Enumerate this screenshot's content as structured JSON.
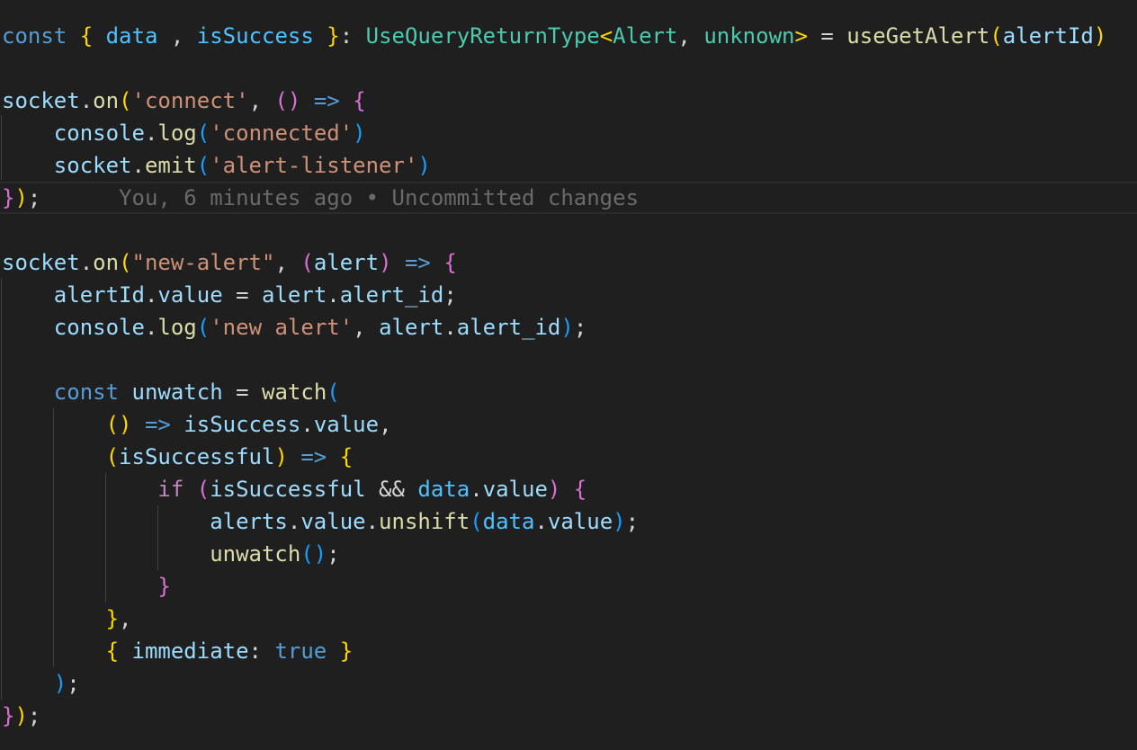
{
  "colors": {
    "background": "#1f1f1f",
    "keyword": "#569cd6",
    "control": "#c586c0",
    "variable": "#9cdcfe",
    "constant": "#4fc1ff",
    "function": "#dcdcaa",
    "type": "#4ec9b0",
    "string": "#ce9178",
    "bracket1": "#ffd700",
    "bracket2": "#da70d6",
    "bracket3": "#179fff",
    "punct": "#d4d4d4",
    "blame": "#6a6a6a",
    "guide": "#404040"
  },
  "lines": [
    {
      "name": "line-const-query",
      "tokens": [
        [
          "const",
          "keyword"
        ],
        [
          " ",
          "punct"
        ],
        [
          "{",
          "bracket1"
        ],
        [
          " ",
          "punct"
        ],
        [
          "data",
          "constant"
        ],
        [
          " , ",
          "punct"
        ],
        [
          "isSuccess",
          "constant"
        ],
        [
          " ",
          "punct"
        ],
        [
          "}",
          "bracket1"
        ],
        [
          ": ",
          "punct"
        ],
        [
          "UseQueryReturnType",
          "type"
        ],
        [
          "<",
          "bracket1"
        ],
        [
          "Alert",
          "type"
        ],
        [
          ", ",
          "punct"
        ],
        [
          "unknown",
          "type"
        ],
        [
          ">",
          "bracket1"
        ],
        [
          " = ",
          "punct"
        ],
        [
          "useGetAlert",
          "function"
        ],
        [
          "(",
          "bracket1"
        ],
        [
          "alertId",
          "variable"
        ],
        [
          ")",
          "bracket1"
        ]
      ]
    },
    {
      "name": "line-empty-1",
      "tokens": []
    },
    {
      "name": "line-socket-on-connect",
      "tokens": [
        [
          "socket",
          "variable"
        ],
        [
          ".",
          "punct"
        ],
        [
          "on",
          "function"
        ],
        [
          "(",
          "bracket1"
        ],
        [
          "'connect'",
          "string"
        ],
        [
          ", ",
          "punct"
        ],
        [
          "()",
          "bracket2"
        ],
        [
          " ",
          "punct"
        ],
        [
          "=>",
          "keyword"
        ],
        [
          " ",
          "punct"
        ],
        [
          "{",
          "bracket2"
        ]
      ]
    },
    {
      "name": "line-console-log-connected",
      "tokens": [
        [
          "    ",
          "punct"
        ],
        [
          "console",
          "variable"
        ],
        [
          ".",
          "punct"
        ],
        [
          "log",
          "function"
        ],
        [
          "(",
          "bracket3"
        ],
        [
          "'connected'",
          "string"
        ],
        [
          ")",
          "bracket3"
        ]
      ]
    },
    {
      "name": "line-socket-emit",
      "tokens": [
        [
          "    ",
          "punct"
        ],
        [
          "socket",
          "variable"
        ],
        [
          ".",
          "punct"
        ],
        [
          "emit",
          "function"
        ],
        [
          "(",
          "bracket3"
        ],
        [
          "'alert-listener'",
          "string"
        ],
        [
          ")",
          "bracket3"
        ]
      ]
    },
    {
      "name": "line-close-connect",
      "current": true,
      "tokens": [
        [
          "}",
          "bracket2"
        ],
        [
          ")",
          "bracket1"
        ],
        [
          ";",
          "punct"
        ]
      ],
      "blame": "      You, 6 minutes ago • Uncommitted changes"
    },
    {
      "name": "line-empty-2",
      "tokens": []
    },
    {
      "name": "line-socket-on-new-alert",
      "tokens": [
        [
          "socket",
          "variable"
        ],
        [
          ".",
          "punct"
        ],
        [
          "on",
          "function"
        ],
        [
          "(",
          "bracket1"
        ],
        [
          "\"new-alert\"",
          "string"
        ],
        [
          ", ",
          "punct"
        ],
        [
          "(",
          "bracket2"
        ],
        [
          "alert",
          "variable"
        ],
        [
          ")",
          "bracket2"
        ],
        [
          " ",
          "punct"
        ],
        [
          "=>",
          "keyword"
        ],
        [
          " ",
          "punct"
        ],
        [
          "{",
          "bracket2"
        ]
      ]
    },
    {
      "name": "line-alertid-assign",
      "tokens": [
        [
          "    ",
          "punct"
        ],
        [
          "alertId",
          "variable"
        ],
        [
          ".",
          "punct"
        ],
        [
          "value",
          "variable"
        ],
        [
          " = ",
          "punct"
        ],
        [
          "alert",
          "variable"
        ],
        [
          ".",
          "punct"
        ],
        [
          "alert_id",
          "variable"
        ],
        [
          ";",
          "punct"
        ]
      ]
    },
    {
      "name": "line-console-log-new-alert",
      "tokens": [
        [
          "    ",
          "punct"
        ],
        [
          "console",
          "variable"
        ],
        [
          ".",
          "punct"
        ],
        [
          "log",
          "function"
        ],
        [
          "(",
          "bracket3"
        ],
        [
          "'new alert'",
          "string"
        ],
        [
          ", ",
          "punct"
        ],
        [
          "alert",
          "variable"
        ],
        [
          ".",
          "punct"
        ],
        [
          "alert_id",
          "variable"
        ],
        [
          ")",
          "bracket3"
        ],
        [
          ";",
          "punct"
        ]
      ]
    },
    {
      "name": "line-empty-3",
      "tokens": []
    },
    {
      "name": "line-const-unwatch",
      "tokens": [
        [
          "    ",
          "punct"
        ],
        [
          "const",
          "keyword"
        ],
        [
          " ",
          "punct"
        ],
        [
          "unwatch",
          "variable"
        ],
        [
          " = ",
          "punct"
        ],
        [
          "watch",
          "function"
        ],
        [
          "(",
          "bracket3"
        ]
      ]
    },
    {
      "name": "line-watch-source",
      "tokens": [
        [
          "        ",
          "punct"
        ],
        [
          "()",
          "bracket1"
        ],
        [
          " ",
          "punct"
        ],
        [
          "=>",
          "keyword"
        ],
        [
          " ",
          "punct"
        ],
        [
          "isSuccess",
          "variable"
        ],
        [
          ".",
          "punct"
        ],
        [
          "value",
          "variable"
        ],
        [
          ",",
          "punct"
        ]
      ]
    },
    {
      "name": "line-watch-callback",
      "tokens": [
        [
          "        ",
          "punct"
        ],
        [
          "(",
          "bracket1"
        ],
        [
          "isSuccessful",
          "variable"
        ],
        [
          ")",
          "bracket1"
        ],
        [
          " ",
          "punct"
        ],
        [
          "=>",
          "keyword"
        ],
        [
          " ",
          "punct"
        ],
        [
          "{",
          "bracket1"
        ]
      ]
    },
    {
      "name": "line-if",
      "tokens": [
        [
          "            ",
          "punct"
        ],
        [
          "if",
          "control"
        ],
        [
          " ",
          "punct"
        ],
        [
          "(",
          "bracket2"
        ],
        [
          "isSuccessful",
          "variable"
        ],
        [
          " && ",
          "punct"
        ],
        [
          "data",
          "constant"
        ],
        [
          ".",
          "punct"
        ],
        [
          "value",
          "variable"
        ],
        [
          ")",
          "bracket2"
        ],
        [
          " ",
          "punct"
        ],
        [
          "{",
          "bracket2"
        ]
      ]
    },
    {
      "name": "line-unshift",
      "tokens": [
        [
          "                ",
          "punct"
        ],
        [
          "alerts",
          "variable"
        ],
        [
          ".",
          "punct"
        ],
        [
          "value",
          "variable"
        ],
        [
          ".",
          "punct"
        ],
        [
          "unshift",
          "function"
        ],
        [
          "(",
          "bracket3"
        ],
        [
          "data",
          "constant"
        ],
        [
          ".",
          "punct"
        ],
        [
          "value",
          "variable"
        ],
        [
          ")",
          "bracket3"
        ],
        [
          ";",
          "punct"
        ]
      ]
    },
    {
      "name": "line-unwatch-call",
      "tokens": [
        [
          "                ",
          "punct"
        ],
        [
          "unwatch",
          "function"
        ],
        [
          "()",
          "bracket3"
        ],
        [
          ";",
          "punct"
        ]
      ]
    },
    {
      "name": "line-close-if",
      "tokens": [
        [
          "            ",
          "punct"
        ],
        [
          "}",
          "bracket2"
        ]
      ]
    },
    {
      "name": "line-close-callback",
      "tokens": [
        [
          "        ",
          "punct"
        ],
        [
          "}",
          "bracket1"
        ],
        [
          ",",
          "punct"
        ]
      ]
    },
    {
      "name": "line-options",
      "tokens": [
        [
          "        ",
          "punct"
        ],
        [
          "{",
          "bracket1"
        ],
        [
          " ",
          "punct"
        ],
        [
          "immediate",
          "variable"
        ],
        [
          ": ",
          "punct"
        ],
        [
          "true",
          "keyword"
        ],
        [
          " ",
          "punct"
        ],
        [
          "}",
          "bracket1"
        ]
      ]
    },
    {
      "name": "line-close-watch",
      "tokens": [
        [
          "    ",
          "punct"
        ],
        [
          ")",
          "bracket3"
        ],
        [
          ";",
          "punct"
        ]
      ]
    },
    {
      "name": "line-close-new-alert",
      "tokens": [
        [
          "}",
          "bracket2"
        ],
        [
          ")",
          "bracket1"
        ],
        [
          ";",
          "punct"
        ]
      ]
    }
  ]
}
